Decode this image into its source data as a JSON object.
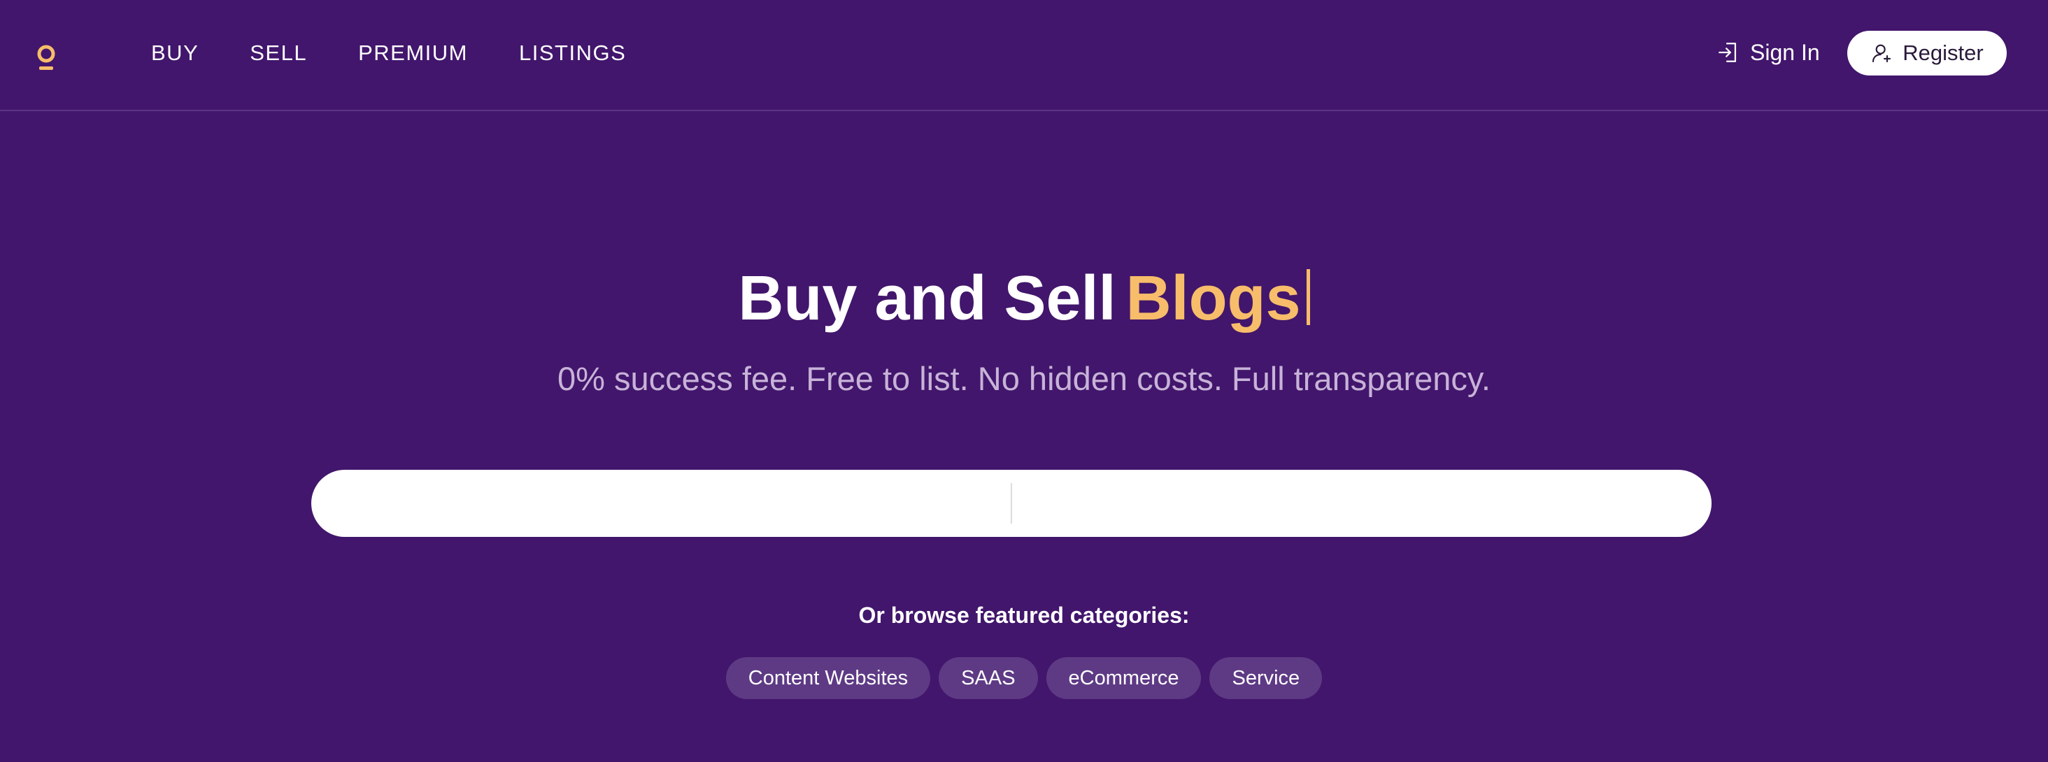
{
  "colors": {
    "background": "#42166c",
    "accent": "#f7bd6a",
    "subtitle": "#c7b3d8",
    "chip_bg": "#5e3a85",
    "button_bg": "#ffffff"
  },
  "header": {
    "logo_icon": "location-pin-icon",
    "nav": [
      {
        "label": "BUY"
      },
      {
        "label": "SELL"
      },
      {
        "label": "PREMIUM"
      },
      {
        "label": "LISTINGS"
      }
    ],
    "sign_in": {
      "label": "Sign In",
      "icon": "login-icon"
    },
    "register": {
      "label": "Register",
      "icon": "user-icon"
    }
  },
  "hero": {
    "title_static": "Buy and Sell",
    "title_rotating": "Blogs",
    "subtitle": "0% success fee. Free to list. No hidden costs. Full transparency."
  },
  "search": {
    "left_value": "",
    "right_value": ""
  },
  "categories": {
    "label": "Or browse featured categories:",
    "items": [
      {
        "label": "Content Websites"
      },
      {
        "label": "SAAS"
      },
      {
        "label": "eCommerce"
      },
      {
        "label": "Service"
      }
    ]
  }
}
